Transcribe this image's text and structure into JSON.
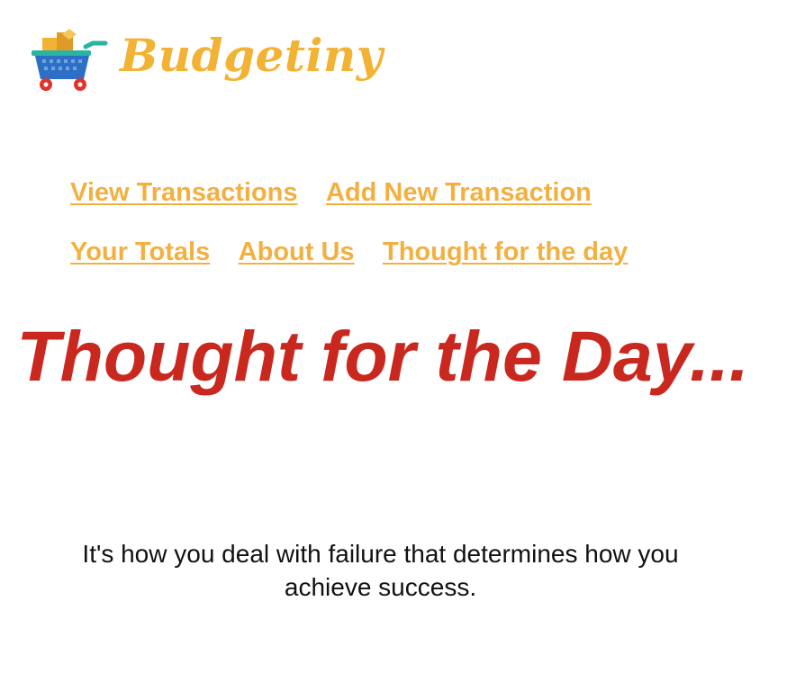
{
  "brand": {
    "name": "Budgetiny",
    "logo_icon": "shopping-cart-icon",
    "colors": {
      "brand_text": "#f2b233",
      "cart_body": "#2d6fc4",
      "cart_wheels": "#e0342a",
      "boxes": "#f2b233",
      "handle": "#2bb3a3"
    }
  },
  "nav": {
    "row1": [
      {
        "label": "View Transactions"
      },
      {
        "label": "Add New Transaction"
      }
    ],
    "row2": [
      {
        "label": "Your Totals"
      },
      {
        "label": "About Us"
      },
      {
        "label": "Thought for the day"
      }
    ],
    "link_color": "#f3b041"
  },
  "main": {
    "heading": "Thought for the Day...",
    "heading_color": "#c9281f",
    "quote_line1": "It's how you deal with failure that determines how you",
    "quote_line2": "achieve success."
  }
}
